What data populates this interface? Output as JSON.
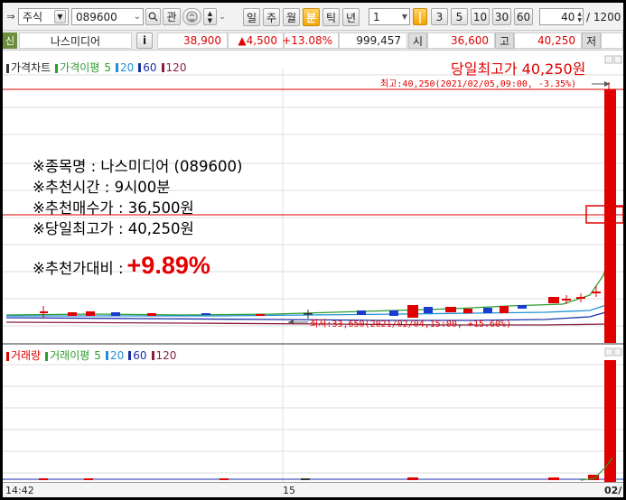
{
  "toolbar": {
    "market_type": "주식",
    "stock_code": "089600",
    "search_btn": "관",
    "periods": [
      "일",
      "주",
      "월",
      "분",
      "틱",
      "년"
    ],
    "active_period": "분",
    "unit_value": "1",
    "minutes": [
      "3",
      "5",
      "10",
      "30",
      "60"
    ],
    "count_value": "40",
    "max_count": "/ 1200"
  },
  "info": {
    "tag": "신",
    "stock_name": "나스미디어",
    "info_btn": "i",
    "price": "38,900",
    "change": "▲4,500",
    "change_rate": "+13.08%",
    "volume": "999,457",
    "open_label": "시",
    "open_value": "36,600",
    "high_label": "고",
    "high_value": "40,250",
    "low_label": "저"
  },
  "price_pane": {
    "legend_price": "가격차트",
    "legend_ma": "가격이평",
    "ma_periods": [
      "5",
      "20",
      "60",
      "120"
    ],
    "headline": "당일최고가 40,250원",
    "high_annotation": "최고:40,250(2021/02/05,09:00, -3.35%)",
    "low_annotation": "최저:33,650(2021/02/04,15:00, +15.60%)"
  },
  "volume_pane": {
    "legend_volume": "거래량",
    "legend_ma": "거래이평",
    "ma_periods": [
      "5",
      "20",
      "60",
      "120"
    ]
  },
  "xaxis": {
    "labels": [
      "14:42",
      "15",
      "02/"
    ]
  },
  "overlay": {
    "lines": [
      "※종목명 : 나스미디어 (089600)",
      "※추천시간 : 9시00분",
      "※추천매수가 : 36,500원",
      "※당일최고가 : 40,250원"
    ],
    "ratio_label": "※추천가대비 : ",
    "ratio_value": "+9.89%"
  },
  "colors": {
    "up": "#e00000",
    "down": "#1a3ccf",
    "ma5": "#2e9b2e",
    "ma20": "#1f8fd6",
    "ma60": "#1a2ea8",
    "ma120": "#8a2040",
    "accent": "#f2a400"
  }
}
